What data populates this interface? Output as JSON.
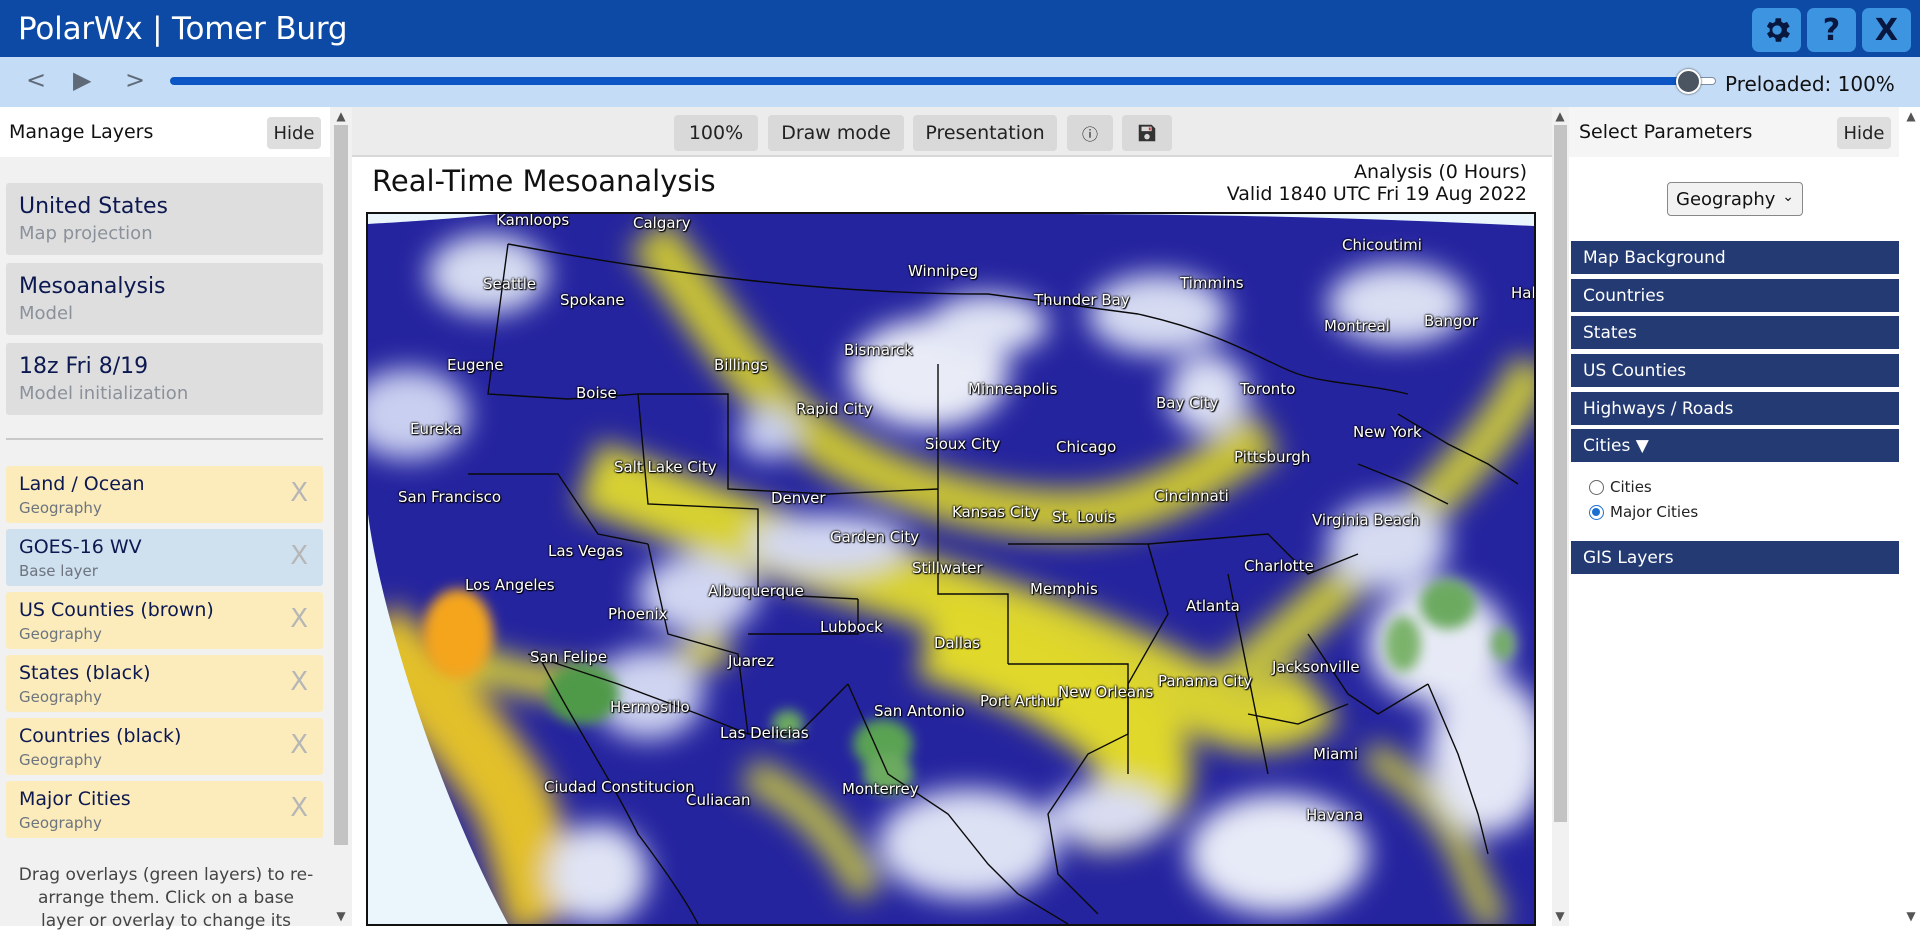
{
  "header": {
    "title": "PolarWx | Tomer Burg",
    "settings_icon": "gear-icon",
    "help_label": "?",
    "close_label": "X",
    "color": "#0c4aa6"
  },
  "timeline": {
    "prev_label": "<",
    "play_label": "▶",
    "next_label": ">",
    "progress": 1.0,
    "preloaded_label": "Preloaded: 100%"
  },
  "left_panel": {
    "title": "Manage Layers",
    "hide_label": "Hide",
    "info_cards": [
      {
        "main": "United States",
        "sub": "Map projection"
      },
      {
        "main": "Mesoanalysis",
        "sub": "Model"
      },
      {
        "main": "18z Fri 8/19",
        "sub": "Model initialization"
      }
    ],
    "layers": [
      {
        "name": "Land / Ocean",
        "type": "Geography",
        "remove": "X"
      },
      {
        "name": "GOES-16 WV",
        "type": "Base layer",
        "remove": "X"
      },
      {
        "name": "US Counties (brown)",
        "type": "Geography",
        "remove": "X"
      },
      {
        "name": "States (black)",
        "type": "Geography",
        "remove": "X"
      },
      {
        "name": "Countries (black)",
        "type": "Geography",
        "remove": "X"
      },
      {
        "name": "Major Cities",
        "type": "Geography",
        "remove": "X"
      }
    ],
    "help_text": "Drag overlays (green layers) to re-arrange them. Click on a base layer or overlay to change its"
  },
  "toolbar": {
    "zoom_label": "100%",
    "draw_label": "Draw mode",
    "presentation_label": "Presentation",
    "info_label": "ⓘ",
    "save_icon": "save-icon"
  },
  "map": {
    "title": "Real-Time Mesoanalysis",
    "analysis_line1": "Analysis (0 Hours)",
    "analysis_line2": "Valid 1840 UTC Fri 19 Aug 2022",
    "cities": [
      "Kamloops",
      "Calgary",
      "Winnipeg",
      "Chicoutimi",
      "Seattle",
      "Spokane",
      "Thunder Bay",
      "Timmins",
      "Hal",
      "Montreal",
      "Bangor",
      "Eugene",
      "Billings",
      "Bismarck",
      "Minneapolis",
      "Toronto",
      "Bay City",
      "Boise",
      "Rapid City",
      "Eureka",
      "Sioux City",
      "Chicago",
      "New York",
      "Pittsburgh",
      "Salt Lake City",
      "San Francisco",
      "Denver",
      "Cincinnati",
      "Kansas City",
      "St. Louis",
      "Virginia Beach",
      "Garden City",
      "Las Vegas",
      "Charlotte",
      "Los Angeles",
      "Stillwater",
      "Albuquerque",
      "Memphis",
      "Atlanta",
      "Phoenix",
      "Lubbock",
      "Dallas",
      "San Felipe",
      "Juarez",
      "Jacksonville",
      "Panama City",
      "Hermosillo",
      "San Antonio",
      "Port Arthur",
      "New Orleans",
      "Las Delicias",
      "Miami",
      "Ciudad Constitucion",
      "Monterrey",
      "Culiacan",
      "Havana"
    ]
  },
  "right_panel": {
    "title": "Select Parameters",
    "hide_label": "Hide",
    "select_value": "Geography",
    "items": [
      "Map Background",
      "Countries",
      "States",
      "US Counties",
      "Highways / Roads",
      "Cities ▼",
      "GIS Layers"
    ],
    "radios": [
      {
        "label": "Cities",
        "checked": false
      },
      {
        "label": "Major Cities",
        "checked": true
      }
    ]
  }
}
